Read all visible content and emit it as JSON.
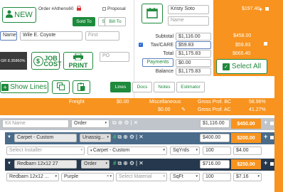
{
  "header": {
    "new_label": "NEW",
    "order_label": "Order #Athens60",
    "proposal_label": "Proposal",
    "tabs": [
      "Sold To",
      "Ship To",
      "Bill To"
    ],
    "name_select": "Name",
    "customer_name": "Wile E. Coyote",
    "first_placeholder": "First",
    "job_number": "GR 8.35860%",
    "job_cost_label": "JOB COST",
    "print_label": "PRINT",
    "po_placeholder": "PO",
    "show_lines_label": "Show Lines"
  },
  "contact": {
    "name": "Kristy Soto",
    "name_placeholder": "Name"
  },
  "totals": {
    "subtotal_label": "Subtotal",
    "subtotal": "$1,116.00",
    "tax_label": "Tax/CARE",
    "tax": "$59.83",
    "total_label": "Total",
    "total": "$1,175.83",
    "payments_label": "Payments",
    "payments": "$0.00",
    "balance_label": "Balance",
    "balance": "$1,175.83"
  },
  "side_values": {
    "top": "$197.40",
    "subtotal": "$458.00",
    "tax": "$59.83",
    "total": "$665.40"
  },
  "select_all_label": "Select All",
  "tabs2": [
    "Lines",
    "Docs",
    "Notes",
    "Estimator"
  ],
  "summary": {
    "freight_label": "Freight",
    "freight": "$0.00",
    "misc_label": "Miscellaneous",
    "misc": "$0.00",
    "gp_bc_label": "Gross Prof. BC",
    "gp_bc": "58.96%",
    "gp_ac_label": "Gross Prof. AC",
    "gp_ac": "41.27%"
  },
  "kit": {
    "name_placeholder": "Kit Name",
    "type": "Order",
    "price": "$1,116.00",
    "badge": "$450.00"
  },
  "line1": {
    "product": "Carpet - Custom",
    "assign": "Unassig...",
    "price": "$400.00",
    "badge": "$200.00",
    "installer_placeholder": "Select Installer",
    "product2": "Carpet - Custom",
    "unit": "SqYrds",
    "qty": "100",
    "unit_price": "$4.00"
  },
  "line2": {
    "product": "Redbarn 12x12 27",
    "type": "Order",
    "price": "$716.00",
    "badge": "$250.00",
    "product2": "Redbarn 12x12 ...",
    "color": "Purple",
    "material_placeholder": "Select Material",
    "unit": "SqFt",
    "qty": "100",
    "unit_price": "$7.16"
  },
  "colors": {
    "green": "#1e8a3c",
    "orange": "#f7931e",
    "navy": "#25384d"
  }
}
